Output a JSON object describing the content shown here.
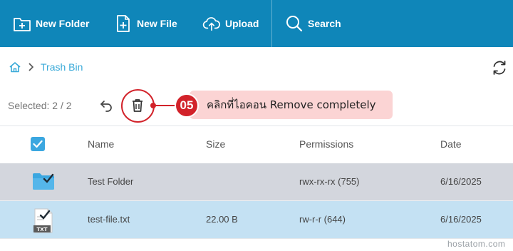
{
  "toolbar": {
    "new_folder": "New Folder",
    "new_file": "New File",
    "upload": "Upload",
    "search": "Search",
    "bg_color": "#0f86b9"
  },
  "breadcrumb": {
    "current": "Trash Bin"
  },
  "selection": {
    "label": "Selected: 2 / 2"
  },
  "annotation": {
    "step": "05",
    "text": "คลิกที่ไอคอน Remove completely",
    "accent": "#d2222a"
  },
  "table": {
    "columns": [
      "Name",
      "Size",
      "Permissions",
      "Date"
    ],
    "rows": [
      {
        "name": "Test Folder",
        "size": "",
        "permissions": "rwx-rx-rx (755)",
        "date": "6/16/2025",
        "icon": "folder-check-icon"
      },
      {
        "name": "test-file.txt",
        "size": "22.00 B",
        "permissions": "rw-r-r (644)",
        "date": "6/16/2025",
        "icon": "txt-file-check-icon"
      }
    ]
  },
  "watermark": "hostatom.com"
}
